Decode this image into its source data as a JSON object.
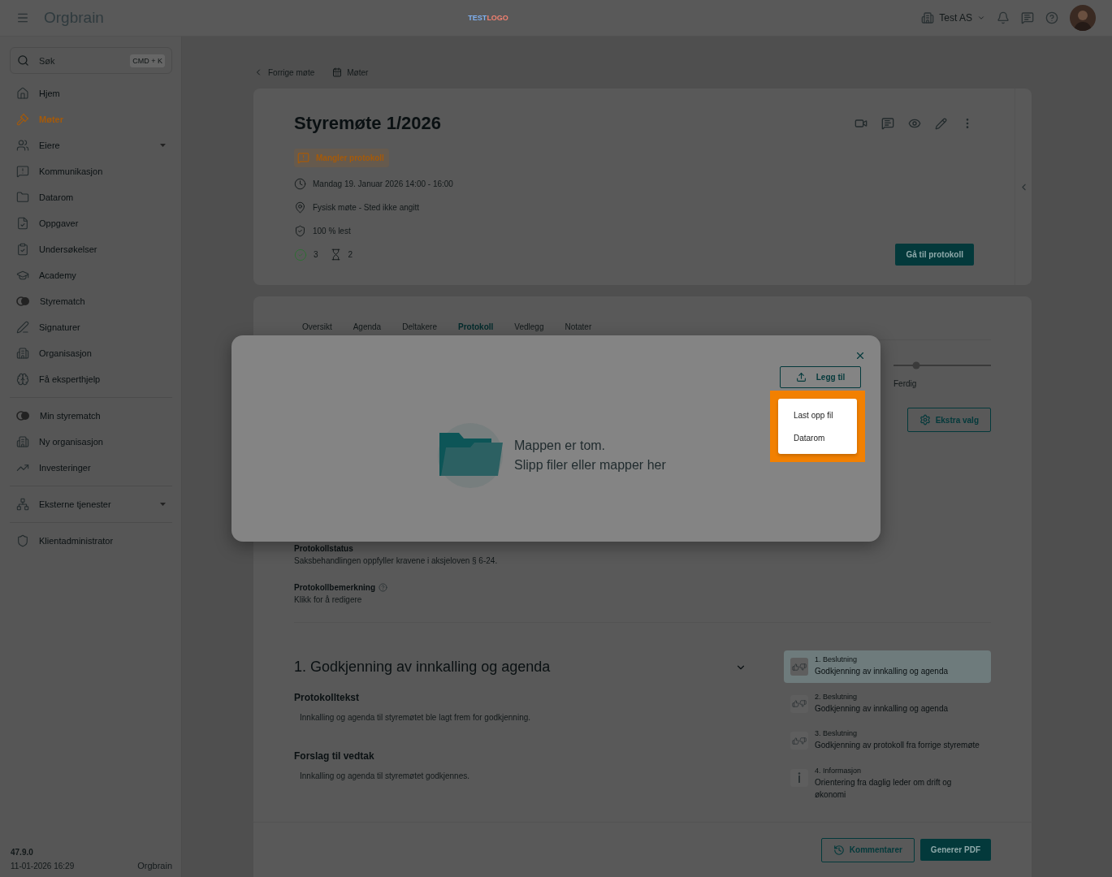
{
  "topbar": {
    "logo": "Orgbrain",
    "center_logo": [
      {
        "text": "TEST",
        "color": "#7fb0f0"
      },
      {
        "text": "LOGO",
        "color": "#f08070"
      }
    ],
    "organization": "Test AS"
  },
  "sidebar": {
    "search": {
      "placeholder": "Søk",
      "shortcut": "CMD + K"
    },
    "groups": [
      {
        "items": [
          {
            "label": "Hjem",
            "selected": false
          },
          {
            "label": "Møter",
            "selected": true
          },
          {
            "label": "Eiere",
            "selected": false,
            "expandable": true
          },
          {
            "label": "Kommunikasjon",
            "selected": false
          },
          {
            "label": "Datarom",
            "selected": false
          },
          {
            "label": "Oppgaver",
            "selected": false
          },
          {
            "label": "Undersøkelser",
            "selected": false
          },
          {
            "label": "Academy",
            "selected": false
          },
          {
            "label": "Styrematch",
            "selected": false
          },
          {
            "label": "Signaturer",
            "selected": false
          },
          {
            "label": "Organisasjon",
            "selected": false
          },
          {
            "label": "Få eksperthjelp",
            "selected": false
          }
        ]
      },
      {
        "items": [
          {
            "label": "Min styrematch",
            "selected": false
          },
          {
            "label": "Ny organisasjon",
            "selected": false
          },
          {
            "label": "Investeringer",
            "selected": false
          }
        ]
      },
      {
        "items": [
          {
            "label": "Eksterne tjenester",
            "selected": false,
            "expandable": true
          }
        ]
      },
      {
        "items": [
          {
            "label": "Klientadministrator",
            "selected": false
          }
        ]
      }
    ],
    "version": "47.9.0",
    "timestamp": "11-01-2026 16:29",
    "footer_logo": "Orgbrain"
  },
  "breadcrumb": [
    {
      "label": "Forrige møte",
      "kind": "back"
    },
    {
      "label": "Møter",
      "kind": "meetings"
    }
  ],
  "meeting": {
    "title": "Styremøte 1/2026",
    "status": "Mangler protokoll",
    "details": [
      {
        "kind": "time",
        "text": "Mandag 19. Januar 2026 14:00 - 16:00"
      },
      {
        "kind": "location",
        "text": "Fysisk møte - Sted ikke angitt"
      },
      {
        "kind": "read",
        "text": "100 % lest"
      }
    ],
    "accepted": "3",
    "pending": "2",
    "primary_button": "Gå til protokoll"
  },
  "tabs": [
    {
      "label": "Oversikt",
      "selected": false
    },
    {
      "label": "Agenda",
      "selected": false
    },
    {
      "label": "Deltakere",
      "selected": false
    },
    {
      "label": "Protokoll",
      "selected": true
    },
    {
      "label": "Vedlegg",
      "selected": false
    },
    {
      "label": "Notater",
      "selected": false
    }
  ],
  "stepper": {
    "last_step": "Ferdig"
  },
  "extra_button": "Ekstra valg",
  "protocol": {
    "status_label": "Protokollstatus",
    "status_text": "Saksbehandlingen oppfyller kravene i aksjeloven § 6-24.",
    "remark_label": "Protokollbemerkning",
    "remark_text": "Klikk for å redigere"
  },
  "agenda_item": {
    "title": "1. Godkjenning av innkalling og agenda",
    "sections": [
      {
        "heading": "Protokolltekst",
        "text": "Innkalling og agenda til styremøtet ble lagt frem for godkjenning."
      },
      {
        "heading": "Forslag til vedtak",
        "text": "Innkalling og agenda til styremøtet godkjennes."
      }
    ]
  },
  "agenda_list": [
    {
      "kind": "decision",
      "label": "1. Beslutning",
      "title": "Godkjenning av innkalling og agenda",
      "selected": true
    },
    {
      "kind": "decision",
      "label": "2. Beslutning",
      "title": "Godkjenning av innkalling og agenda",
      "selected": false
    },
    {
      "kind": "decision",
      "label": "3. Beslutning",
      "title": "Godkjenning av protokoll fra forrige styremøte",
      "selected": false
    },
    {
      "kind": "info",
      "label": "4. Informasjon",
      "title": "Orientering fra daglig leder om drift og økonomi",
      "selected": false
    }
  ],
  "footer_buttons": [
    {
      "label": "Kommentarer",
      "kind": "outline"
    },
    {
      "label": "Generer PDF",
      "kind": "primary"
    }
  ],
  "modal": {
    "empty_title": "Mappen er tom.",
    "empty_hint": "Slipp filer eller mapper her",
    "add_button": "Legg til",
    "menu": [
      "Last opp fil",
      "Datarom"
    ],
    "menu_highlighted": true
  }
}
